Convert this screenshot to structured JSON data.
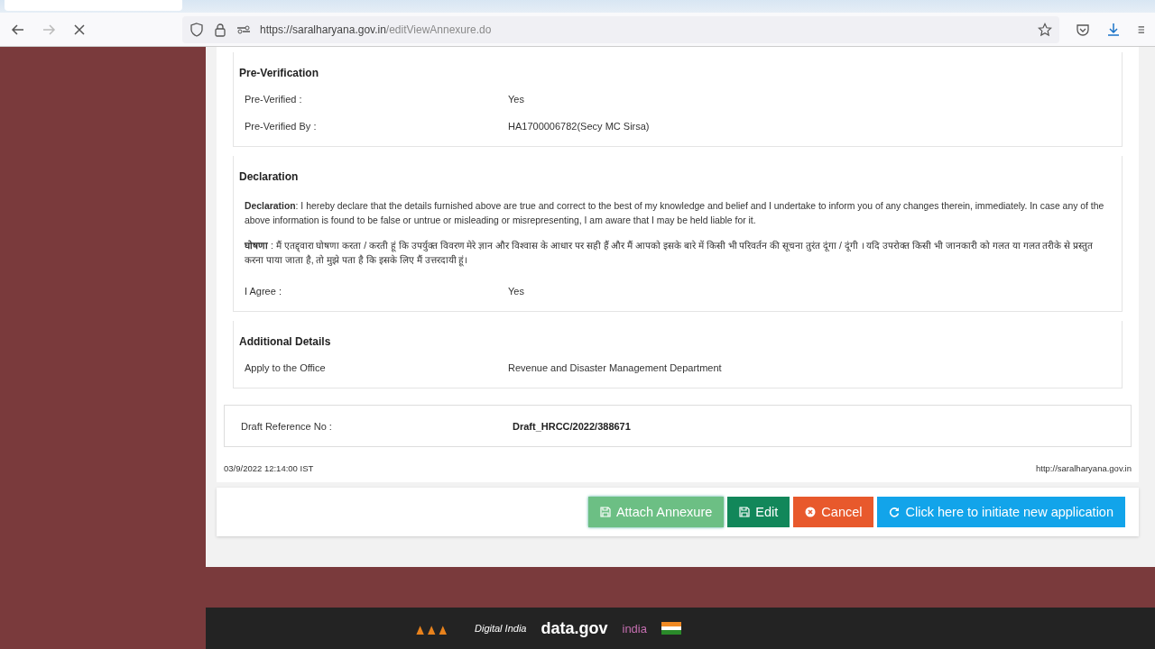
{
  "browser": {
    "url_host": "https://saralharyana.gov.in",
    "url_path": "/editViewAnnexure.do"
  },
  "sections": [
    {
      "title": "Pre-Verification",
      "rows": [
        {
          "label": "Pre-Verified :",
          "value": "Yes"
        },
        {
          "label": "Pre-Verified By :",
          "value": "HA1700006782(Secy MC Sirsa)"
        }
      ]
    },
    {
      "title": "Declaration",
      "paragraphs": [
        "**Declaration**: I hereby declare that the details furnished above are true and correct to the best of my knowledge and belief and I undertake to inform you of any changes therein, immediately. In case any of the above information is found to be false or untrue or misleading or misrepresenting, I am aware that I may be held liable for it.",
        "**घोषणा** : मैं एतद्द्वारा घोषणा करता / करती हूं कि उपर्युक्त विवरण मेरे ज्ञान और विश्वास के आधार पर सही हैं और मैं आपको इसके बारे में किसी भी परिवर्तन की सूचना तुरंत दूंगा / दूंगी । यदि उपरोक्त किसी भी जानकारी को गलत या गलत तरीके से प्रस्तुत करना पाया जाता है, तो मुझे पता है कि इसके लिए मैं उत्तरदायी हूं।"
      ],
      "rows": [
        {
          "label": "I Agree :",
          "value": "Yes"
        }
      ]
    },
    {
      "title": "Additional Details",
      "rows": [
        {
          "label": "Apply to the Office",
          "value": "Revenue and Disaster Management Department"
        }
      ]
    }
  ],
  "draft": {
    "label": "Draft Reference No :",
    "value": "Draft_HRCC/2022/388671"
  },
  "timestamp": "03/9/2022 12:14:00 IST",
  "site_link": "http://saralharyana.gov.in",
  "buttons": [
    {
      "label": "Attach Annexure",
      "kind": "attach"
    },
    {
      "label": "Edit",
      "kind": "edit"
    },
    {
      "label": "Cancel",
      "kind": "cancel"
    },
    {
      "label": "Click here to initiate new application",
      "kind": "new"
    }
  ],
  "footer_logos": [
    "Digital India",
    "data.gov",
    "india"
  ]
}
